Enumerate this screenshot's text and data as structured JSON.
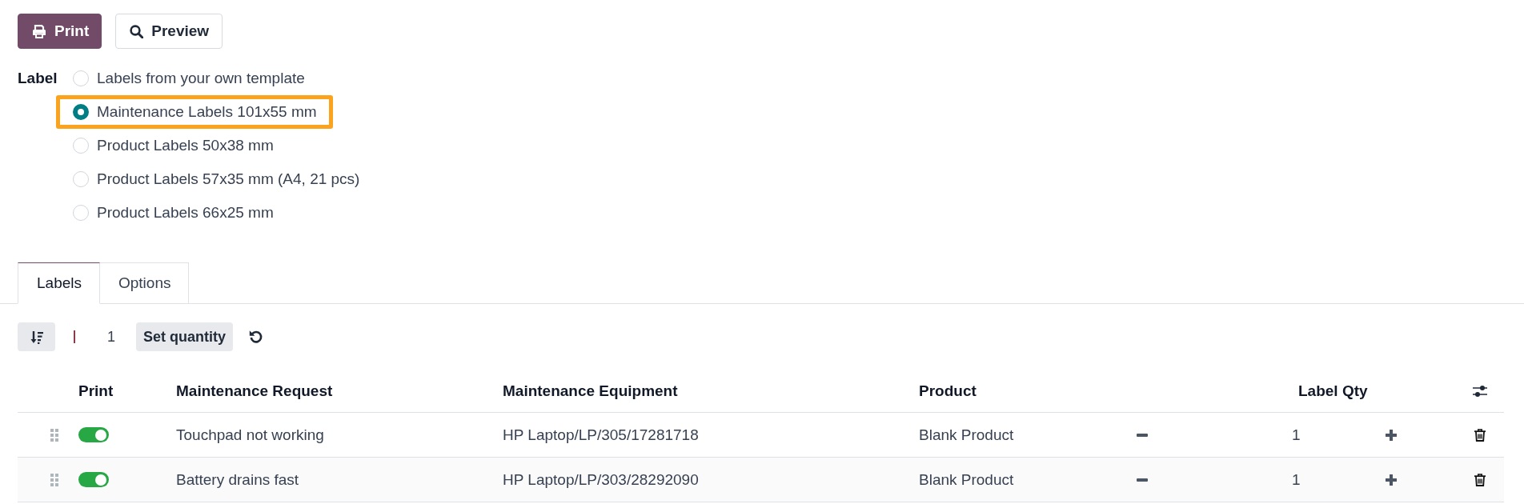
{
  "actions": [
    {
      "kind": "print",
      "label": "Print"
    },
    {
      "kind": "preview",
      "label": "Preview"
    }
  ],
  "label_field": {
    "label": "Label",
    "options": [
      {
        "text": "Labels from your own template",
        "selected": false,
        "highlighted": false
      },
      {
        "text": "Maintenance Labels 101x55 mm",
        "selected": true,
        "highlighted": true
      },
      {
        "text": "Product Labels 50x38 mm",
        "selected": false,
        "highlighted": false
      },
      {
        "text": "Product Labels 57x35 mm (A4, 21 pcs)",
        "selected": false,
        "highlighted": false
      },
      {
        "text": "Product Labels 66x25 mm",
        "selected": false,
        "highlighted": false
      }
    ]
  },
  "tabs": [
    {
      "label": "Labels",
      "selected": true
    },
    {
      "label": "Options",
      "selected": false
    }
  ],
  "toolbar": {
    "quantity": "1",
    "set_button": "Set quantity"
  },
  "table": {
    "columns": [
      "Print",
      "Maintenance Request",
      "Maintenance Equipment",
      "Product",
      "Label Qty"
    ],
    "rows": [
      {
        "print": true,
        "request": "Touchpad not working",
        "equipment": "HP Laptop/LP/305/17281718",
        "product": "Blank Product",
        "qty": "1"
      },
      {
        "print": true,
        "request": "Battery drains fast",
        "equipment": "HP Laptop/LP/303/28292090",
        "product": "Blank Product",
        "qty": "1"
      }
    ]
  }
}
